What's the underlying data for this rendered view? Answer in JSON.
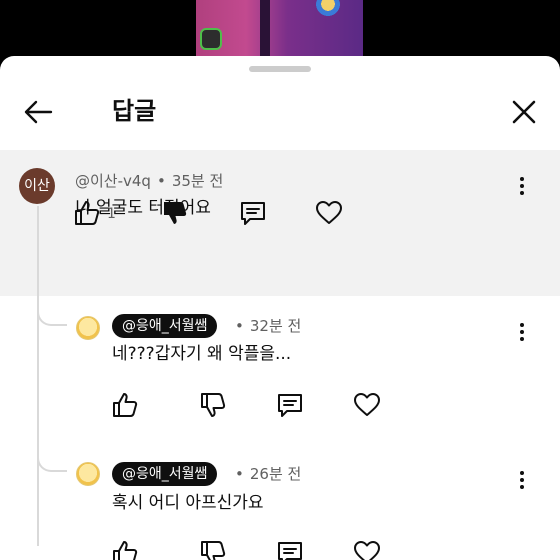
{
  "header": {
    "title": "답글"
  },
  "parent_comment": {
    "avatar_text": "이산",
    "author": "@이산-v4q",
    "time": "35분 전",
    "text": "니 얼굴도 터졌어요",
    "like_count": "1"
  },
  "replies": [
    {
      "author": "@응애_서월쌤",
      "time": "32분 전",
      "text": "네???갑자기 왜 악플을..."
    },
    {
      "author": "@응애_서월쌤",
      "time": "26분 전",
      "text": "혹시 어디 아프신가요"
    }
  ],
  "meta_separator": "•"
}
